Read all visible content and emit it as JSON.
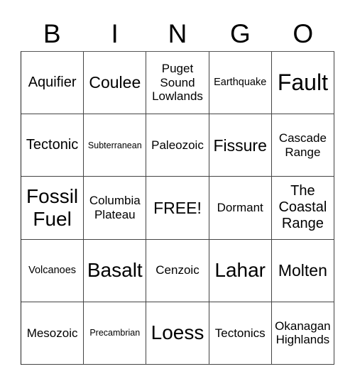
{
  "header": {
    "letters": [
      "B",
      "I",
      "N",
      "G",
      "O"
    ]
  },
  "board": {
    "cells": [
      [
        "Aquifier",
        "Coulee",
        "Puget Sound Lowlands",
        "Earthquake",
        "Fault"
      ],
      [
        "Tectonic",
        "Subterranean",
        "Paleozoic",
        "Fissure",
        "Cascade Range"
      ],
      [
        "Fossil Fuel",
        "Columbia Plateau",
        "FREE!",
        "Dormant",
        "The Coastal Range"
      ],
      [
        "Volcanoes",
        "Basalt",
        "Cenzoic",
        "Lahar",
        "Molten"
      ],
      [
        "Mesozoic",
        "Precambrian",
        "Loess",
        "Tectonics",
        "Okanagan Highlands"
      ]
    ]
  }
}
